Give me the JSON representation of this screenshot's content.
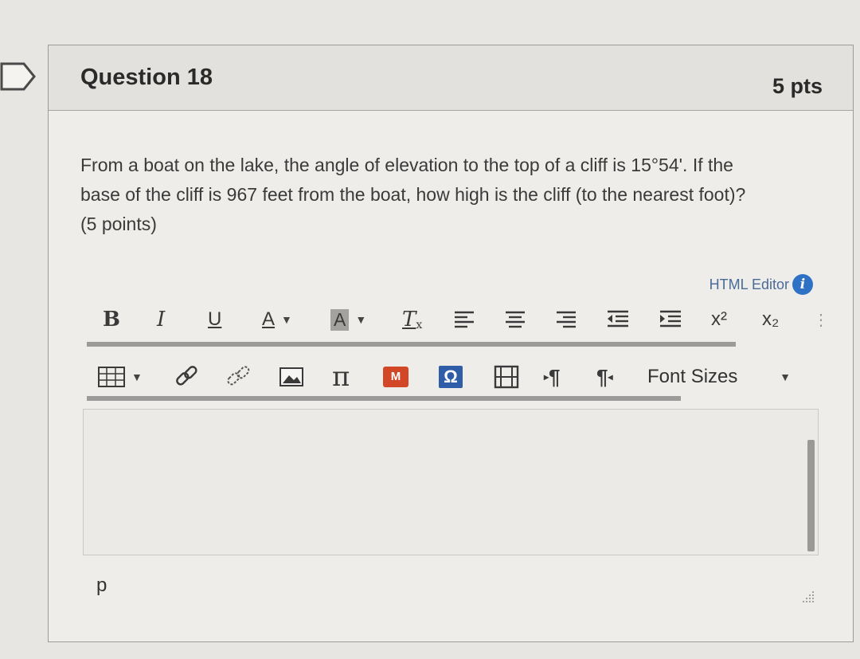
{
  "question": {
    "title": "Question 18",
    "points": "5 pts",
    "text_line1": "From a boat on the lake, the angle of elevation to the top of a cliff is 15°54'. If the",
    "text_line2": "base of the cliff is 967 feet from the boat, how high is the cliff (to the nearest foot)?",
    "text_line3": "(5 points)"
  },
  "editor": {
    "html_editor_link": "HTML Editor",
    "info_icon_text": "i",
    "toolbar1": {
      "bold": "B",
      "italic": "I",
      "underline": "U",
      "font_color": "A",
      "bg_color": "A",
      "clear_format": "T",
      "superscript": "x²",
      "subscript": "x₂"
    },
    "toolbar2": {
      "ltr": "¶",
      "rtl": "¶",
      "office_badge": "M",
      "omega": "Ω",
      "pi": "π",
      "font_sizes": "Font Sizes"
    },
    "body_value": "",
    "status_path": "p"
  },
  "icons": [
    "flag-icon",
    "info-icon",
    "table-icon",
    "link-icon",
    "unlink-icon",
    "image-icon",
    "pi-icon",
    "office-mix-icon",
    "omega-icon",
    "media-icon",
    "ltr-icon",
    "rtl-icon",
    "resize-icon"
  ],
  "colors": {
    "info_blue": "#2f72c5",
    "link_blue": "#4a6b97",
    "office_red": "#d24726",
    "omega_blue": "#2f5da8"
  }
}
